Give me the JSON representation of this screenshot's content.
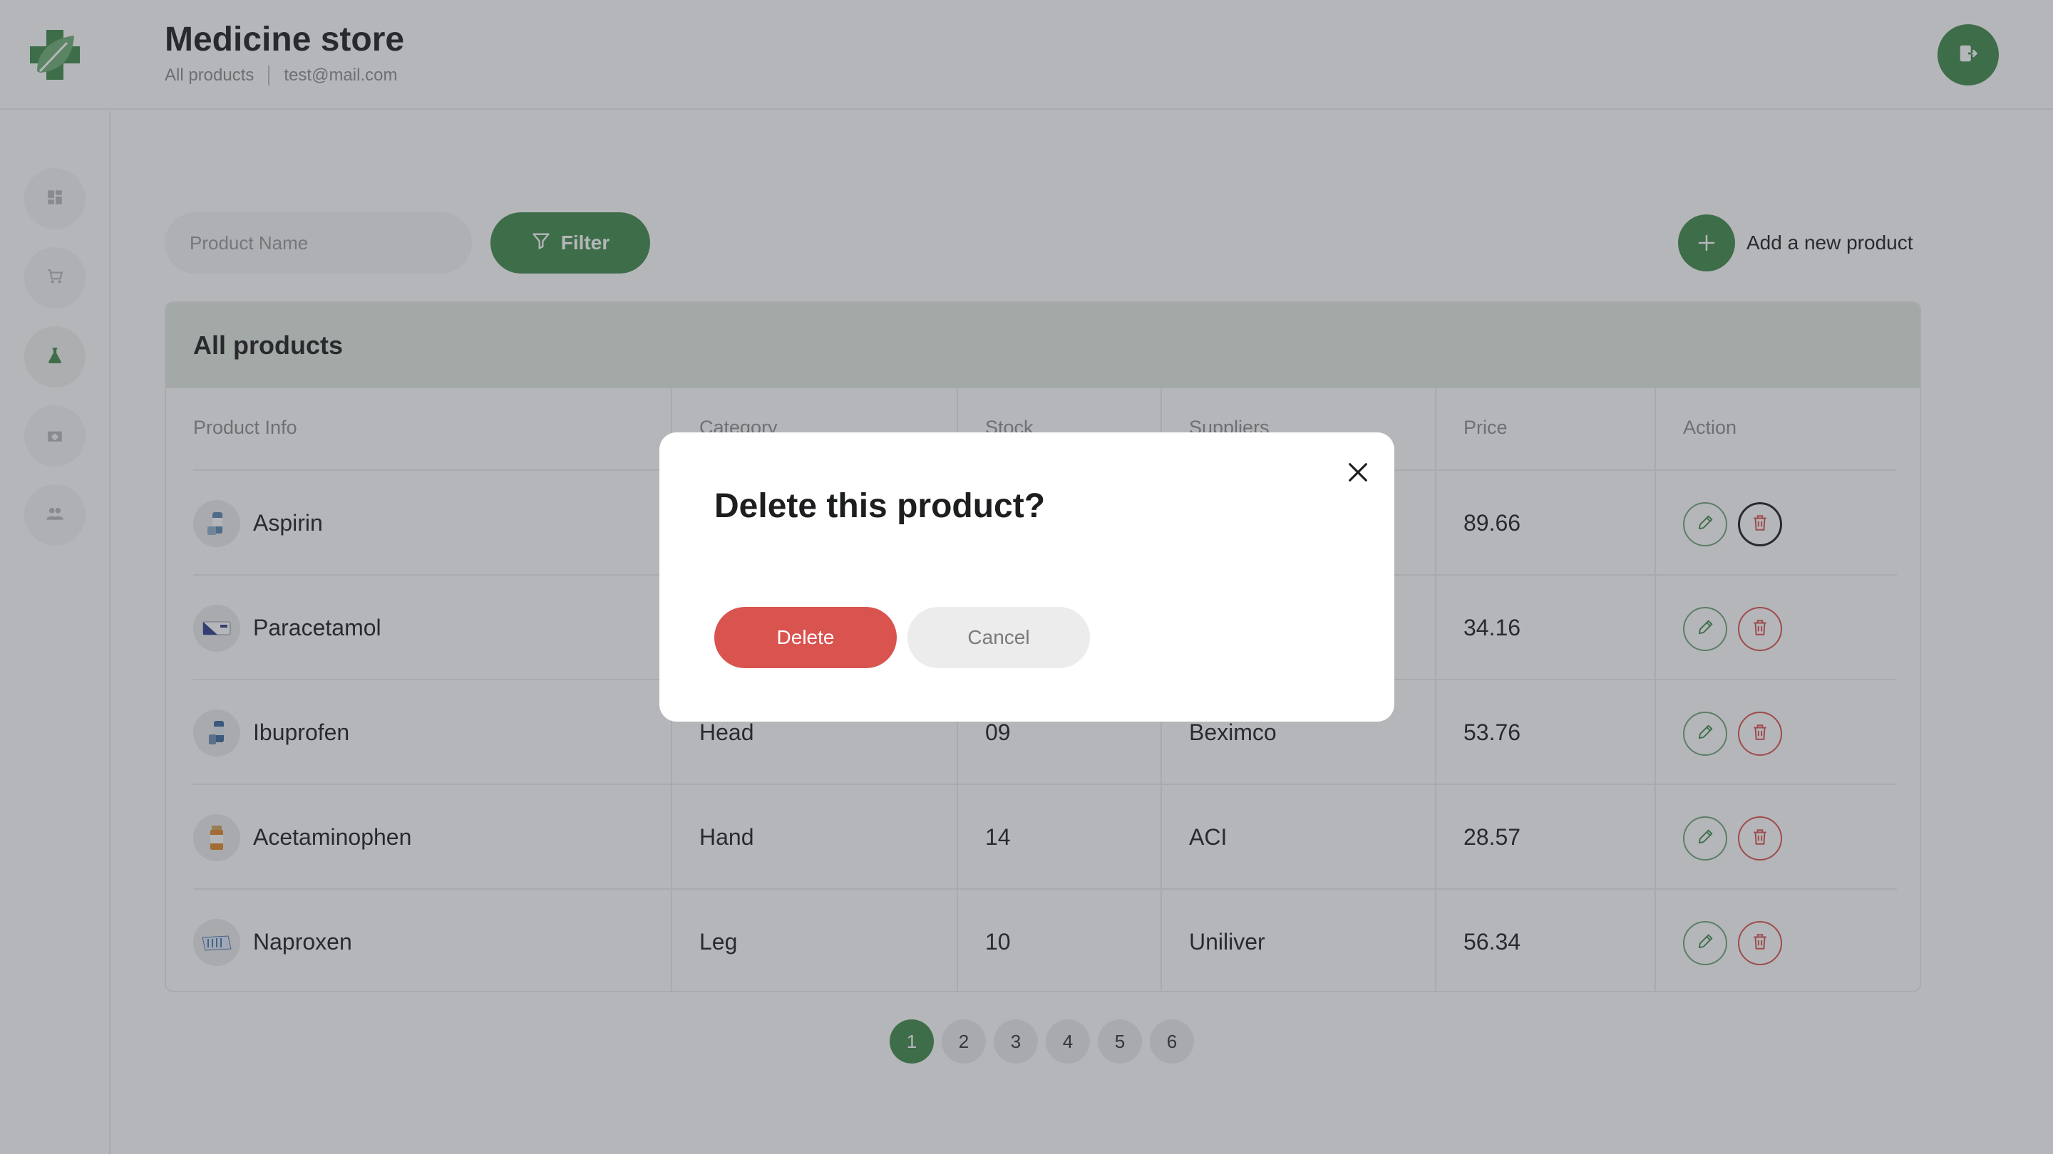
{
  "header": {
    "title": "Medicine store",
    "breadcrumb": "All products",
    "email": "test@mail.com"
  },
  "sidebar": {
    "items": [
      {
        "icon": "dashboard-icon"
      },
      {
        "icon": "cart-icon"
      },
      {
        "icon": "flask-icon",
        "active": true
      },
      {
        "icon": "pharmacy-icon"
      },
      {
        "icon": "users-icon"
      }
    ]
  },
  "toolbar": {
    "search_placeholder": "Product Name",
    "filter_label": "Filter",
    "add_label": "Add a new product"
  },
  "table": {
    "title": "All products",
    "columns": [
      "Product Info",
      "Category",
      "Stock",
      "Suppliers",
      "Price",
      "Action"
    ],
    "rows": [
      {
        "name": "Aspirin",
        "category": "",
        "stock": "",
        "supplier": "",
        "price": "89.66"
      },
      {
        "name": "Paracetamol",
        "category": "",
        "stock": "",
        "supplier": "",
        "price": "34.16"
      },
      {
        "name": "Ibuprofen",
        "category": "Head",
        "stock": "09",
        "supplier": "Beximco",
        "price": "53.76"
      },
      {
        "name": "Acetaminophen",
        "category": "Hand",
        "stock": "14",
        "supplier": "ACI",
        "price": "28.57"
      },
      {
        "name": "Naproxen",
        "category": "Leg",
        "stock": "10",
        "supplier": "Uniliver",
        "price": "56.34"
      }
    ]
  },
  "pagination": {
    "pages": [
      "1",
      "2",
      "3",
      "4",
      "5",
      "6"
    ],
    "current": "1"
  },
  "modal": {
    "title": "Delete this product?",
    "delete_label": "Delete",
    "cancel_label": "Cancel"
  },
  "colors": {
    "accent": "#3f8a4c",
    "danger": "#d9534f",
    "header_band": "#e3ebe3"
  }
}
